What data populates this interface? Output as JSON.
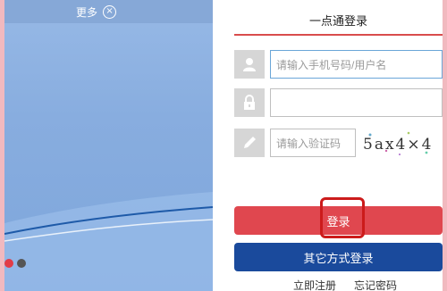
{
  "banner": {
    "more_label": "更多",
    "close_symbol": "×",
    "slide_count": 2,
    "active_slide": 1
  },
  "login": {
    "title": "一点通登录",
    "username_placeholder": "请输入手机号码/用户名",
    "password_placeholder": "",
    "captcha_placeholder": "请输入验证码",
    "captcha_text": "5ax4×4",
    "login_button": "登录",
    "other_login_button": "其它方式登录",
    "register_link": "立即注册",
    "forgot_link": "忘记密码"
  },
  "colors": {
    "primary_red": "#e0474f",
    "primary_blue": "#1a4a9c",
    "highlight_red": "#cc1b1b",
    "banner_blue": "#88addf"
  },
  "icons": [
    "user-icon",
    "lock-icon",
    "pencil-icon",
    "close-icon"
  ]
}
